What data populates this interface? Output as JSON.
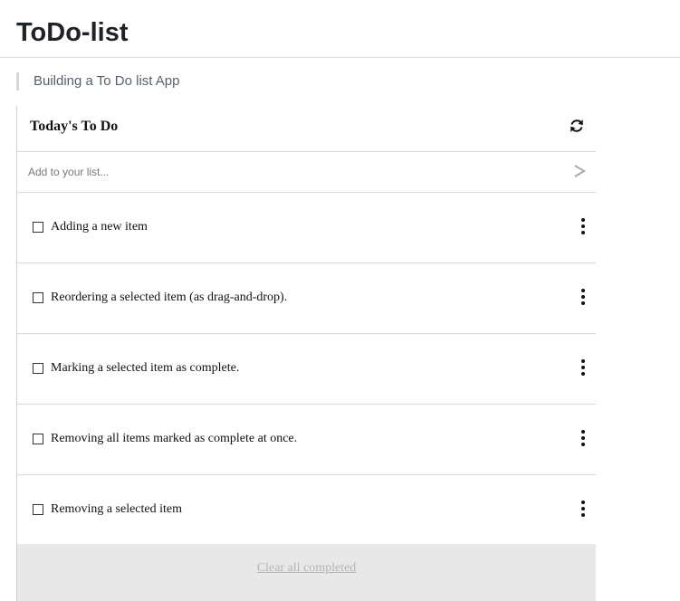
{
  "page": {
    "title": "ToDo-list",
    "subtitle": "Building a To Do list App"
  },
  "card": {
    "title": "Today's To Do",
    "refresh_icon": "refresh-icon",
    "add_input": {
      "placeholder": "Add to your list...",
      "value": ""
    },
    "send_icon": "chevron-right-icon",
    "items": [
      {
        "label": "Adding a new item",
        "checked": false
      },
      {
        "label": "Reordering a selected item (as drag-and-drop).",
        "checked": false
      },
      {
        "label": "Marking a selected item as complete.",
        "checked": false
      },
      {
        "label": "Removing all items marked as complete at once.",
        "checked": false
      },
      {
        "label": "Removing a selected item",
        "checked": false
      }
    ],
    "item_menu_icon": "kebab-menu-icon",
    "clear_label": "Clear all completed"
  },
  "colors": {
    "footer_bg": "#e8e8e8",
    "clear_link": "#b5b5b5",
    "send_icon": "#aaaaaa",
    "divider": "#d8d8d8"
  }
}
